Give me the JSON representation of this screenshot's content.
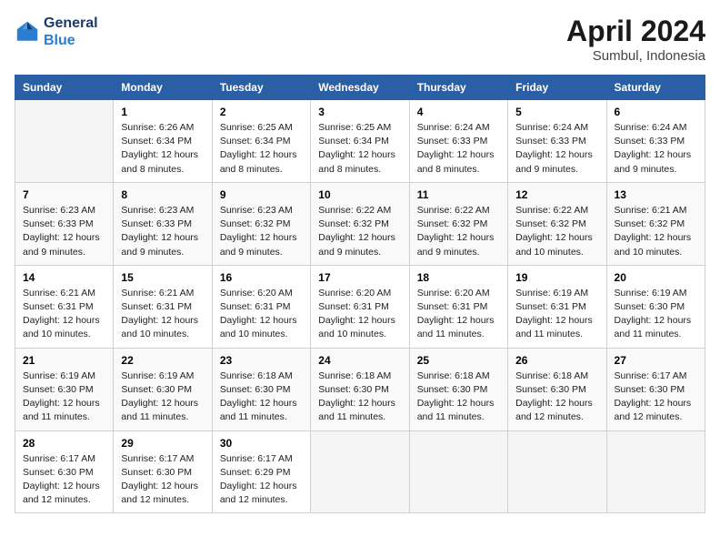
{
  "header": {
    "logo_line1": "General",
    "logo_line2": "Blue",
    "month": "April 2024",
    "location": "Sumbul, Indonesia"
  },
  "weekdays": [
    "Sunday",
    "Monday",
    "Tuesday",
    "Wednesday",
    "Thursday",
    "Friday",
    "Saturday"
  ],
  "weeks": [
    [
      {
        "num": "",
        "sunrise": "",
        "sunset": "",
        "daylight": ""
      },
      {
        "num": "1",
        "sunrise": "Sunrise: 6:26 AM",
        "sunset": "Sunset: 6:34 PM",
        "daylight": "Daylight: 12 hours and 8 minutes."
      },
      {
        "num": "2",
        "sunrise": "Sunrise: 6:25 AM",
        "sunset": "Sunset: 6:34 PM",
        "daylight": "Daylight: 12 hours and 8 minutes."
      },
      {
        "num": "3",
        "sunrise": "Sunrise: 6:25 AM",
        "sunset": "Sunset: 6:34 PM",
        "daylight": "Daylight: 12 hours and 8 minutes."
      },
      {
        "num": "4",
        "sunrise": "Sunrise: 6:24 AM",
        "sunset": "Sunset: 6:33 PM",
        "daylight": "Daylight: 12 hours and 8 minutes."
      },
      {
        "num": "5",
        "sunrise": "Sunrise: 6:24 AM",
        "sunset": "Sunset: 6:33 PM",
        "daylight": "Daylight: 12 hours and 9 minutes."
      },
      {
        "num": "6",
        "sunrise": "Sunrise: 6:24 AM",
        "sunset": "Sunset: 6:33 PM",
        "daylight": "Daylight: 12 hours and 9 minutes."
      }
    ],
    [
      {
        "num": "7",
        "sunrise": "Sunrise: 6:23 AM",
        "sunset": "Sunset: 6:33 PM",
        "daylight": "Daylight: 12 hours and 9 minutes."
      },
      {
        "num": "8",
        "sunrise": "Sunrise: 6:23 AM",
        "sunset": "Sunset: 6:33 PM",
        "daylight": "Daylight: 12 hours and 9 minutes."
      },
      {
        "num": "9",
        "sunrise": "Sunrise: 6:23 AM",
        "sunset": "Sunset: 6:32 PM",
        "daylight": "Daylight: 12 hours and 9 minutes."
      },
      {
        "num": "10",
        "sunrise": "Sunrise: 6:22 AM",
        "sunset": "Sunset: 6:32 PM",
        "daylight": "Daylight: 12 hours and 9 minutes."
      },
      {
        "num": "11",
        "sunrise": "Sunrise: 6:22 AM",
        "sunset": "Sunset: 6:32 PM",
        "daylight": "Daylight: 12 hours and 9 minutes."
      },
      {
        "num": "12",
        "sunrise": "Sunrise: 6:22 AM",
        "sunset": "Sunset: 6:32 PM",
        "daylight": "Daylight: 12 hours and 10 minutes."
      },
      {
        "num": "13",
        "sunrise": "Sunrise: 6:21 AM",
        "sunset": "Sunset: 6:32 PM",
        "daylight": "Daylight: 12 hours and 10 minutes."
      }
    ],
    [
      {
        "num": "14",
        "sunrise": "Sunrise: 6:21 AM",
        "sunset": "Sunset: 6:31 PM",
        "daylight": "Daylight: 12 hours and 10 minutes."
      },
      {
        "num": "15",
        "sunrise": "Sunrise: 6:21 AM",
        "sunset": "Sunset: 6:31 PM",
        "daylight": "Daylight: 12 hours and 10 minutes."
      },
      {
        "num": "16",
        "sunrise": "Sunrise: 6:20 AM",
        "sunset": "Sunset: 6:31 PM",
        "daylight": "Daylight: 12 hours and 10 minutes."
      },
      {
        "num": "17",
        "sunrise": "Sunrise: 6:20 AM",
        "sunset": "Sunset: 6:31 PM",
        "daylight": "Daylight: 12 hours and 10 minutes."
      },
      {
        "num": "18",
        "sunrise": "Sunrise: 6:20 AM",
        "sunset": "Sunset: 6:31 PM",
        "daylight": "Daylight: 12 hours and 11 minutes."
      },
      {
        "num": "19",
        "sunrise": "Sunrise: 6:19 AM",
        "sunset": "Sunset: 6:31 PM",
        "daylight": "Daylight: 12 hours and 11 minutes."
      },
      {
        "num": "20",
        "sunrise": "Sunrise: 6:19 AM",
        "sunset": "Sunset: 6:30 PM",
        "daylight": "Daylight: 12 hours and 11 minutes."
      }
    ],
    [
      {
        "num": "21",
        "sunrise": "Sunrise: 6:19 AM",
        "sunset": "Sunset: 6:30 PM",
        "daylight": "Daylight: 12 hours and 11 minutes."
      },
      {
        "num": "22",
        "sunrise": "Sunrise: 6:19 AM",
        "sunset": "Sunset: 6:30 PM",
        "daylight": "Daylight: 12 hours and 11 minutes."
      },
      {
        "num": "23",
        "sunrise": "Sunrise: 6:18 AM",
        "sunset": "Sunset: 6:30 PM",
        "daylight": "Daylight: 12 hours and 11 minutes."
      },
      {
        "num": "24",
        "sunrise": "Sunrise: 6:18 AM",
        "sunset": "Sunset: 6:30 PM",
        "daylight": "Daylight: 12 hours and 11 minutes."
      },
      {
        "num": "25",
        "sunrise": "Sunrise: 6:18 AM",
        "sunset": "Sunset: 6:30 PM",
        "daylight": "Daylight: 12 hours and 11 minutes."
      },
      {
        "num": "26",
        "sunrise": "Sunrise: 6:18 AM",
        "sunset": "Sunset: 6:30 PM",
        "daylight": "Daylight: 12 hours and 12 minutes."
      },
      {
        "num": "27",
        "sunrise": "Sunrise: 6:17 AM",
        "sunset": "Sunset: 6:30 PM",
        "daylight": "Daylight: 12 hours and 12 minutes."
      }
    ],
    [
      {
        "num": "28",
        "sunrise": "Sunrise: 6:17 AM",
        "sunset": "Sunset: 6:30 PM",
        "daylight": "Daylight: 12 hours and 12 minutes."
      },
      {
        "num": "29",
        "sunrise": "Sunrise: 6:17 AM",
        "sunset": "Sunset: 6:30 PM",
        "daylight": "Daylight: 12 hours and 12 minutes."
      },
      {
        "num": "30",
        "sunrise": "Sunrise: 6:17 AM",
        "sunset": "Sunset: 6:29 PM",
        "daylight": "Daylight: 12 hours and 12 minutes."
      },
      {
        "num": "",
        "sunrise": "",
        "sunset": "",
        "daylight": ""
      },
      {
        "num": "",
        "sunrise": "",
        "sunset": "",
        "daylight": ""
      },
      {
        "num": "",
        "sunrise": "",
        "sunset": "",
        "daylight": ""
      },
      {
        "num": "",
        "sunrise": "",
        "sunset": "",
        "daylight": ""
      }
    ]
  ]
}
